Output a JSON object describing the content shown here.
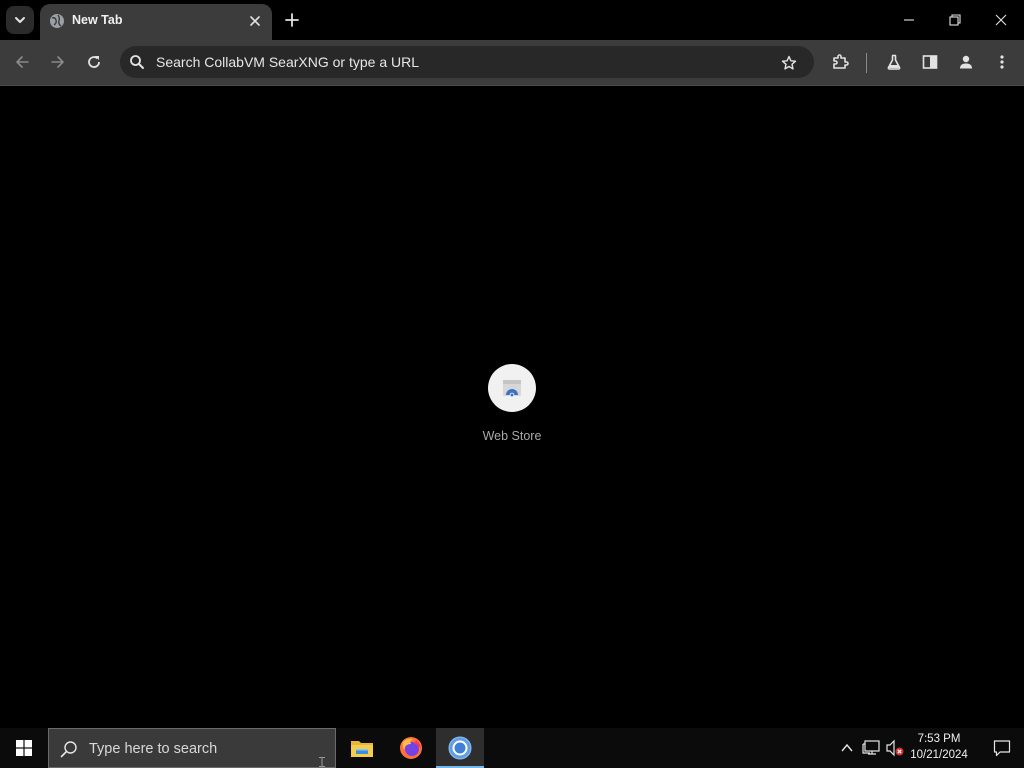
{
  "browser": {
    "tab": {
      "title": "New Tab"
    },
    "omnibox": {
      "placeholder": "Search CollabVM SearXNG or type a URL"
    }
  },
  "content": {
    "shortcuts": [
      {
        "label": "Web Store"
      }
    ]
  },
  "taskbar": {
    "search_placeholder": "Type here to search",
    "clock": {
      "time": "7:53 PM",
      "date": "10/21/2024"
    },
    "apps": [
      "file-explorer",
      "firefox",
      "chrome"
    ]
  },
  "colors": {
    "tab_active": "#3c3c3c",
    "toolbar": "#3c3c3c",
    "omnibox": "#282828",
    "page_background": "#000000",
    "taskbar": "#0b0b0b",
    "taskbar_active_indicator": "#76b9ed"
  },
  "icons": {
    "tab_search": "chevron-down-icon",
    "tab_favicon": "globe-icon",
    "omnibox": "search-icon",
    "bookmark": "star-icon",
    "extensions": "puzzle-icon",
    "labs": "flask-icon",
    "side_panel": "side-panel-icon",
    "profile": "person-icon",
    "menu": "kebab-menu-icon"
  }
}
